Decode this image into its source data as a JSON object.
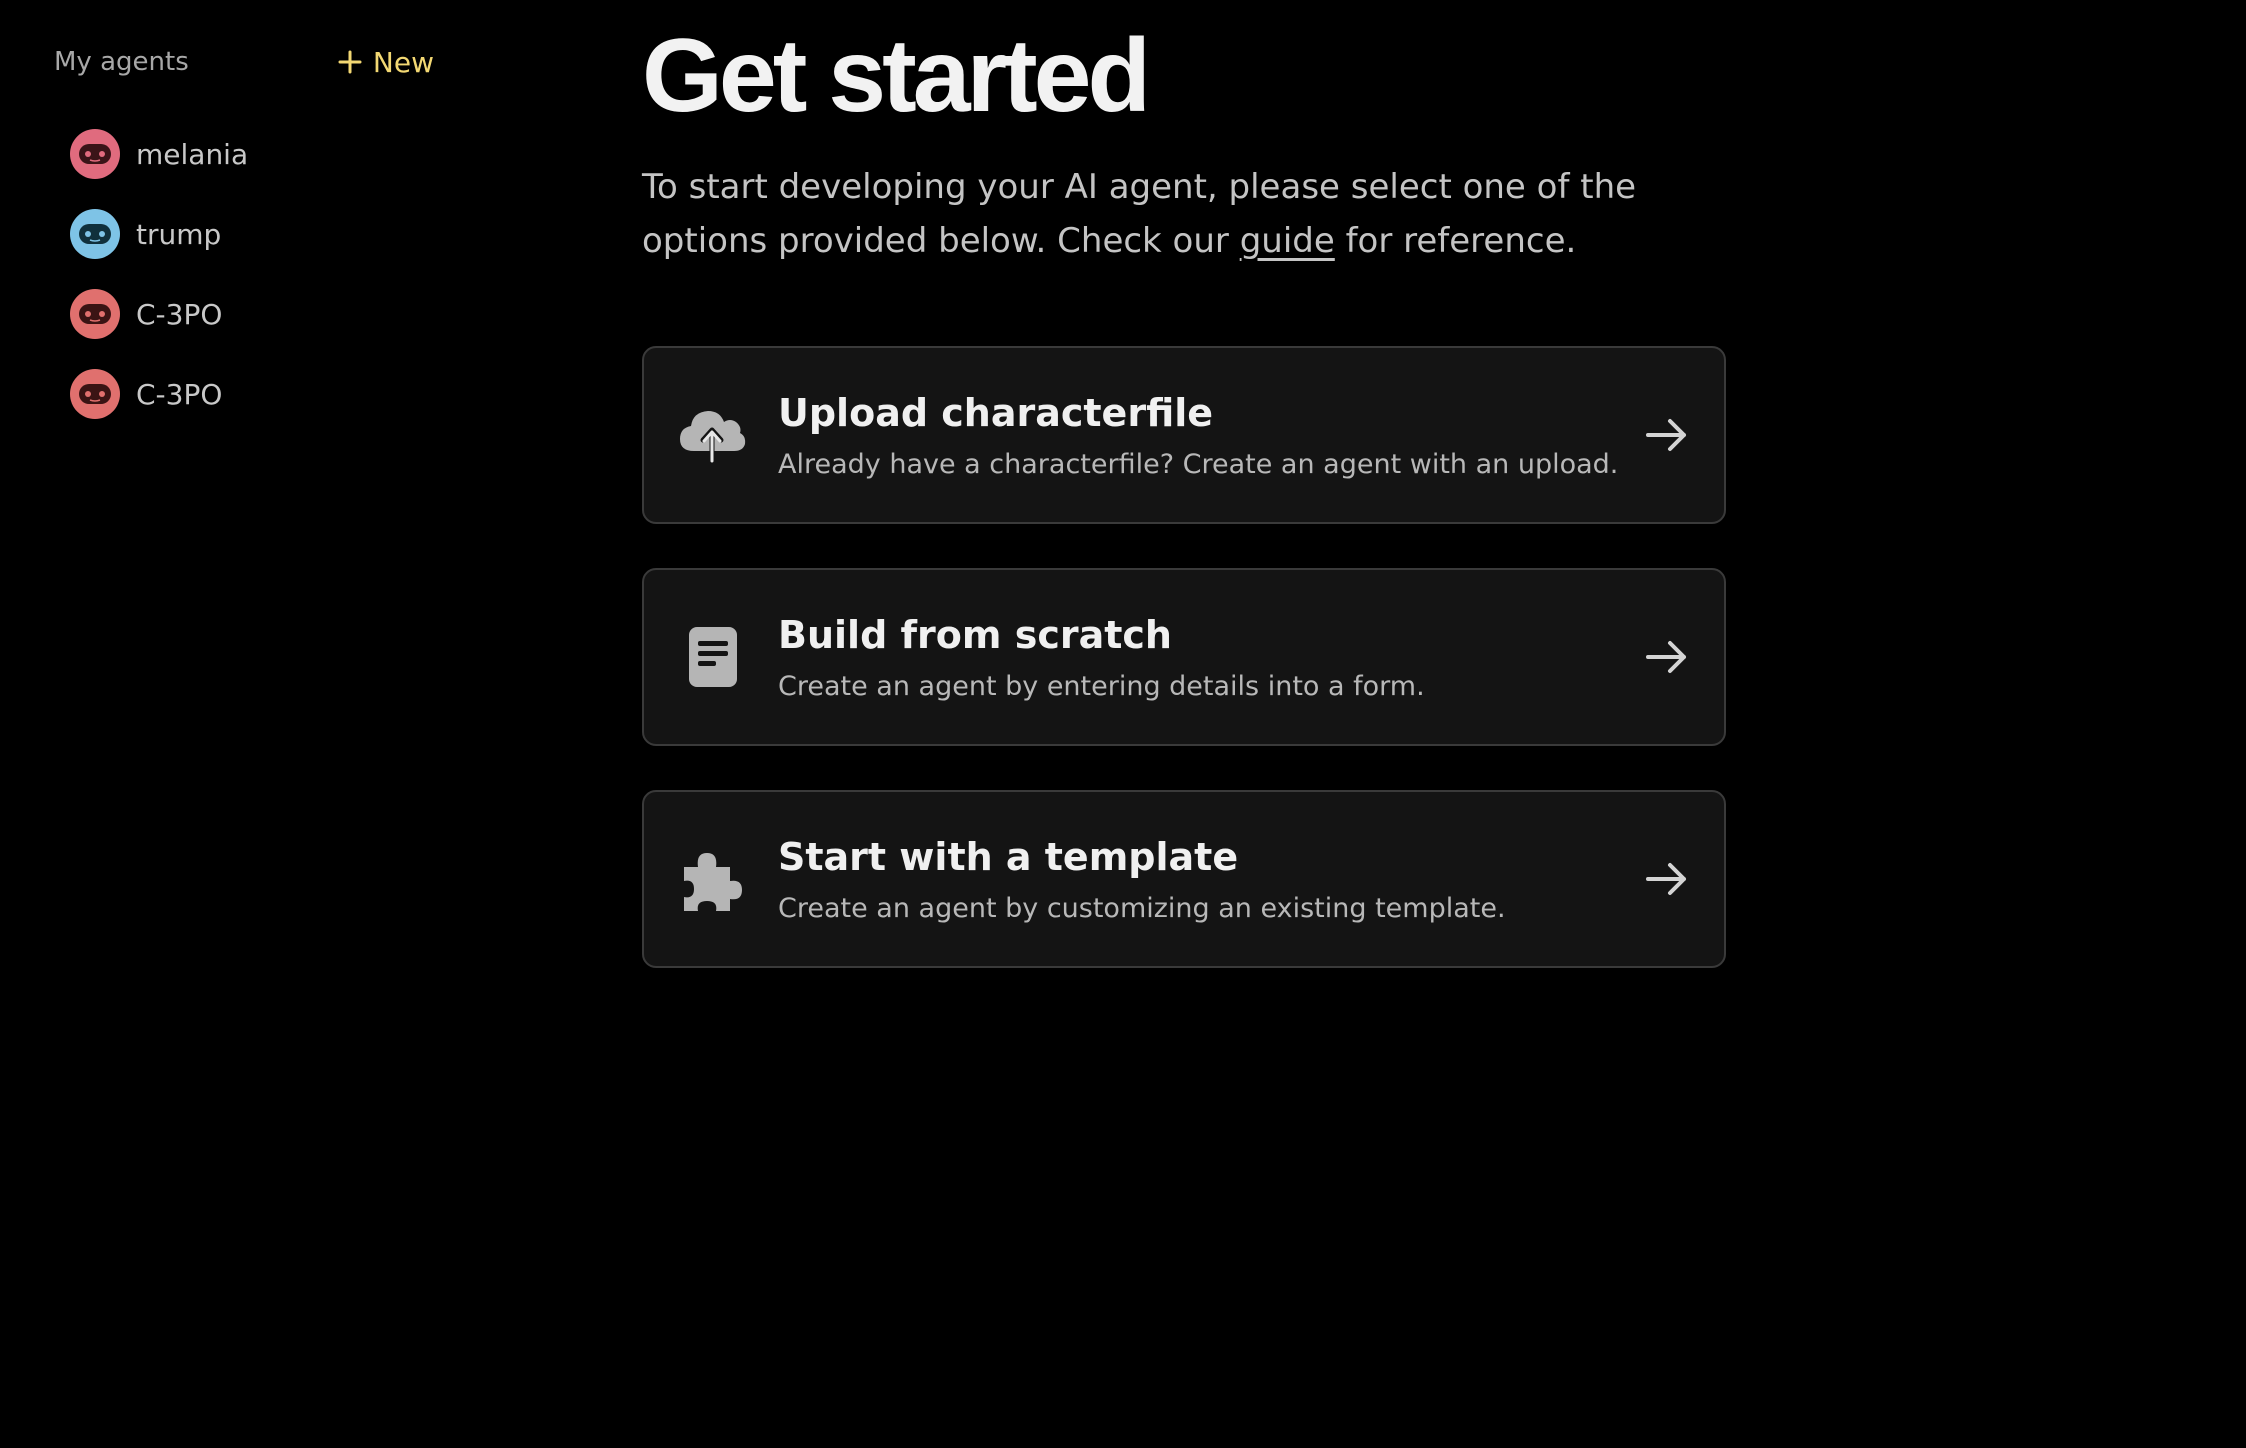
{
  "sidebar": {
    "title": "My agents",
    "new_label": "New",
    "accent_color": "#f3d873",
    "agents": [
      {
        "name": "melania",
        "avatar_color": "#e06b7e",
        "icon": "robot-face-icon"
      },
      {
        "name": "trump",
        "avatar_color": "#7ec3e6",
        "icon": "robot-face-icon"
      },
      {
        "name": "C-3PO",
        "avatar_color": "#e0706e",
        "icon": "robot-face-icon"
      },
      {
        "name": "C-3PO",
        "avatar_color": "#e0706e",
        "icon": "robot-face-icon"
      }
    ]
  },
  "main": {
    "title": "Get started",
    "intro_before": "To start developing your AI agent, please select one of the options provided below. Check our ",
    "guide_link": "guide",
    "intro_after": " for reference.",
    "cards": [
      {
        "title": "Upload characterfile",
        "description": "Already have a characterfile? Create an agent with an upload.",
        "icon": "cloud-upload-icon"
      },
      {
        "title": "Build from scratch",
        "description": "Create an agent by entering details into a form.",
        "icon": "document-icon"
      },
      {
        "title": "Start with a template",
        "description": "Create an agent by customizing an existing template.",
        "icon": "puzzle-icon"
      }
    ]
  }
}
